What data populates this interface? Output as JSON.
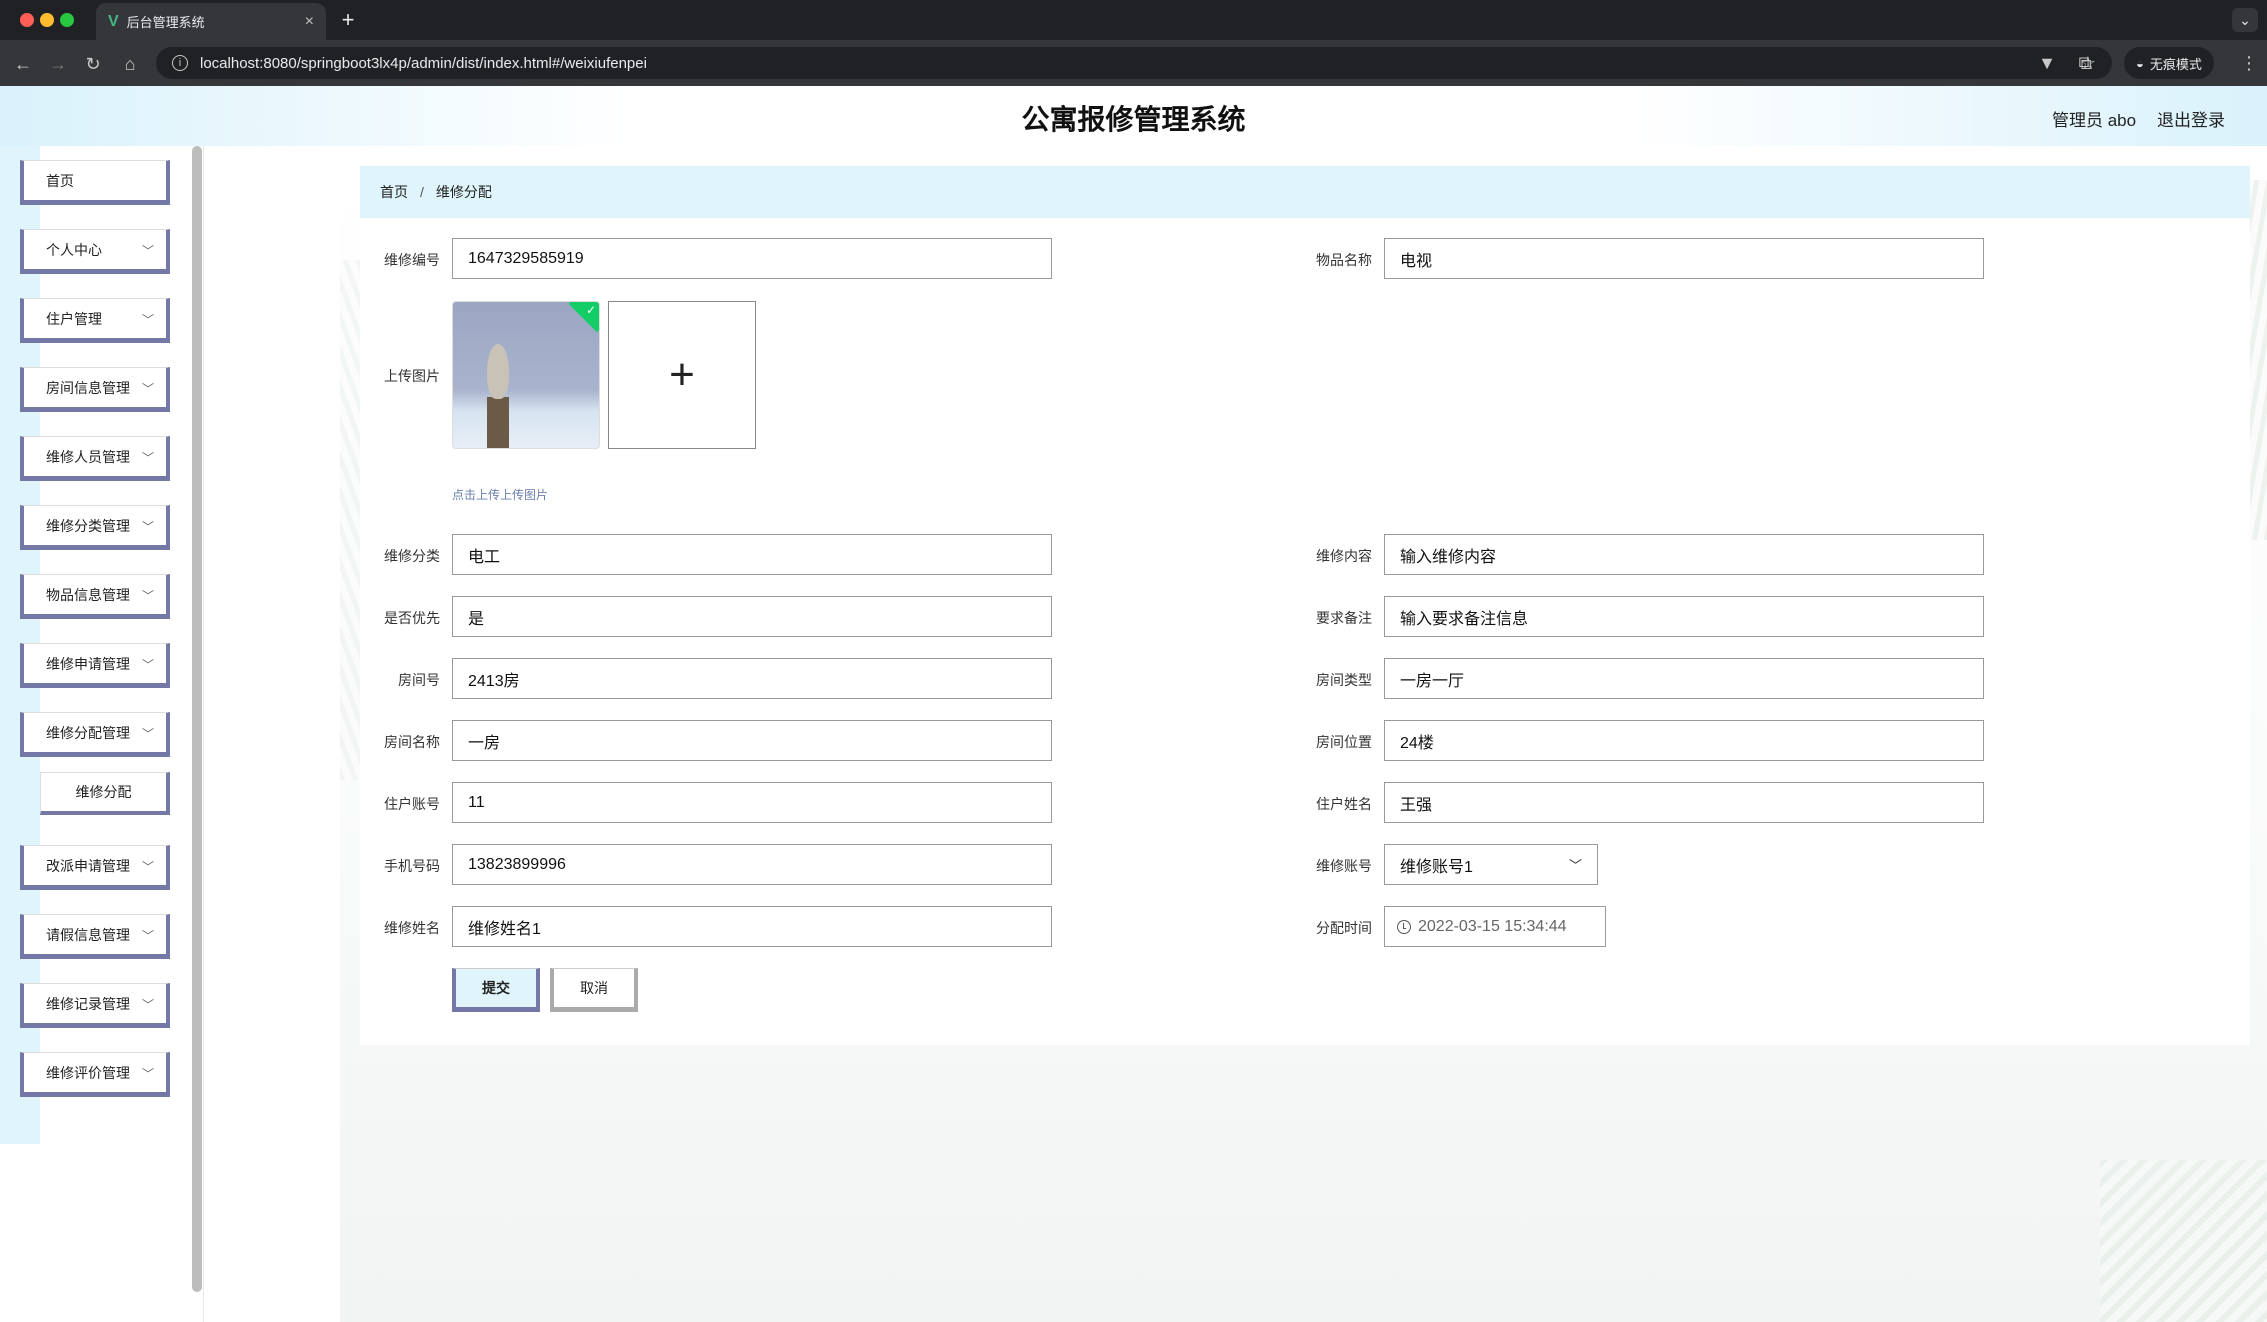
{
  "browser": {
    "tab_title": "后台管理系统",
    "url": "localhost:8080/springboot3lx4p/admin/dist/index.html#/weixiufenpei",
    "incognito_label": "无痕模式"
  },
  "header": {
    "system_title": "公寓报修管理系统",
    "admin_label": "管理员 abo",
    "logout_label": "退出登录"
  },
  "sidebar": {
    "items": [
      {
        "label": "首页"
      },
      {
        "label": "个人中心"
      },
      {
        "label": "住户管理"
      },
      {
        "label": "房间信息管理"
      },
      {
        "label": "维修人员管理"
      },
      {
        "label": "维修分类管理"
      },
      {
        "label": "物品信息管理"
      },
      {
        "label": "维修申请管理"
      },
      {
        "label": "维修分配管理"
      },
      {
        "label": "改派申请管理"
      },
      {
        "label": "请假信息管理"
      },
      {
        "label": "维修记录管理"
      },
      {
        "label": "维修评价管理"
      }
    ],
    "sub_item": "维修分配"
  },
  "breadcrumb": {
    "home": "首页",
    "separator": "/",
    "current": "维修分配"
  },
  "form": {
    "repair_no": {
      "label": "维修编号",
      "value": "1647329585919"
    },
    "item_name": {
      "label": "物品名称",
      "value": "电视"
    },
    "upload": {
      "label": "上传图片",
      "tip": "点击上传上传图片"
    },
    "repair_category": {
      "label": "维修分类",
      "value": "电工"
    },
    "repair_content": {
      "label": "维修内容",
      "value": "输入维修内容"
    },
    "priority": {
      "label": "是否优先",
      "value": "是"
    },
    "remark": {
      "label": "要求备注",
      "value": "输入要求备注信息"
    },
    "room_no": {
      "label": "房间号",
      "value": "2413房"
    },
    "room_type": {
      "label": "房间类型",
      "value": "一房一厅"
    },
    "room_name": {
      "label": "房间名称",
      "value": "一房"
    },
    "room_location": {
      "label": "房间位置",
      "value": "24楼"
    },
    "resident_account": {
      "label": "住户账号",
      "value": "11"
    },
    "resident_name": {
      "label": "住户姓名",
      "value": "王强"
    },
    "phone": {
      "label": "手机号码",
      "value": "13823899996"
    },
    "repair_account": {
      "label": "维修账号",
      "value": "维修账号1"
    },
    "repair_name": {
      "label": "维修姓名",
      "value": "维修姓名1"
    },
    "assign_time": {
      "label": "分配时间",
      "value": "2022-03-15 15:34:44"
    },
    "submit_label": "提交",
    "cancel_label": "取消"
  },
  "colors": {
    "accent_border": "#7478a6",
    "breadcrumb_bg": "#dff4fb",
    "upload_success": "#13ce66"
  }
}
